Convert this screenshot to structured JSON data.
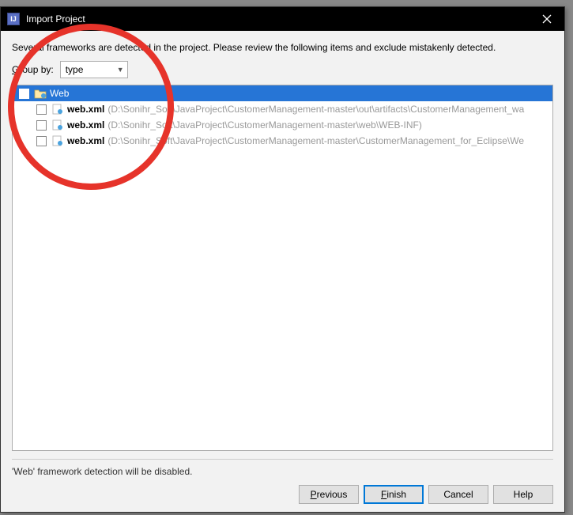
{
  "window": {
    "title": "Import Project",
    "app_badge": "IJ"
  },
  "intro": "Several frameworks are detected in the project. Please review the following items and exclude mistakenly detected.",
  "groupby": {
    "label_pre": "G",
    "label_rest": "roup by:",
    "selected": "type"
  },
  "tree": {
    "root": {
      "label": "Web"
    },
    "items": [
      {
        "label": "web.xml",
        "path": "(D:\\Sonihr_Soft\\JavaProject\\CustomerManagement-master\\out\\artifacts\\CustomerManagement_wa"
      },
      {
        "label": "web.xml",
        "path": "(D:\\Sonihr_Soft\\JavaProject\\CustomerManagement-master\\web\\WEB-INF)"
      },
      {
        "label": "web.xml",
        "path": "(D:\\Sonihr_Soft\\JavaProject\\CustomerManagement-master\\CustomerManagement_for_Eclipse\\We"
      }
    ]
  },
  "status": "'Web' framework detection will be disabled.",
  "buttons": {
    "previous_ul": "P",
    "previous_rest": "revious",
    "finish_ul": "F",
    "finish_rest": "inish",
    "cancel": "Cancel",
    "help": "Help"
  }
}
